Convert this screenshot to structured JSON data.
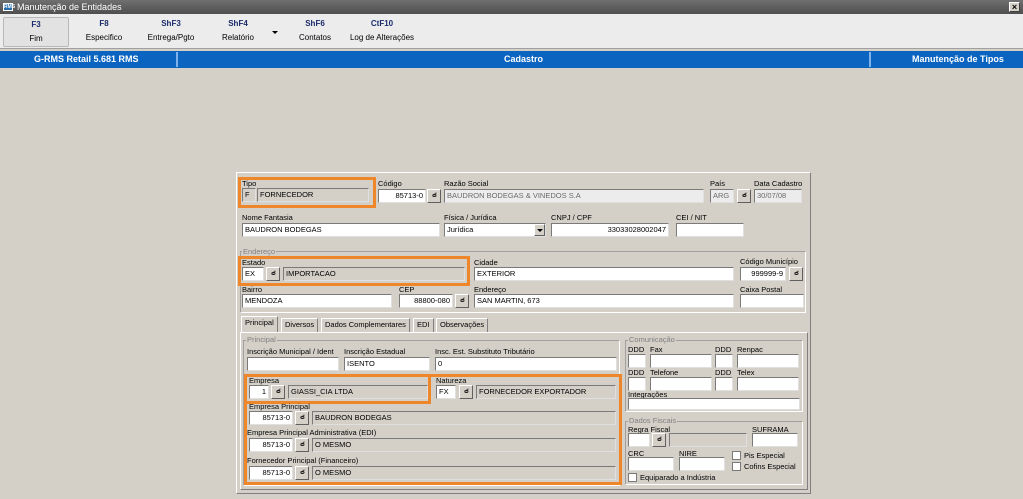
{
  "window": {
    "title": "Manutenção de Entidades",
    "icon": "app-icon"
  },
  "toolbar": {
    "items": [
      {
        "key": "F3",
        "label": "Fim"
      },
      {
        "key": "F8",
        "label": "Especifico"
      },
      {
        "key": "ShF3",
        "label": "Entrega/Pgto"
      },
      {
        "key": "ShF4",
        "label": "Relatório"
      },
      {
        "key": "ShF6",
        "label": "Contatos"
      },
      {
        "key": "CtF10",
        "label": "Log de Alterações"
      }
    ]
  },
  "header": {
    "left": "G-RMS Retail 5.681 RMS",
    "center": "Cadastro",
    "right": "Manutenção de Tipos"
  },
  "form": {
    "tipo": {
      "label": "Tipo",
      "code": "F",
      "desc": "FORNECEDOR"
    },
    "codigo": {
      "label": "Código",
      "value": "85713-0"
    },
    "razao": {
      "label": "Razão Social",
      "value": "BAUDRON BODEGAS & VINEDOS S.A"
    },
    "pais": {
      "label": "País",
      "value": "ARG"
    },
    "data_cadastro": {
      "label": "Data Cadastro",
      "value": "30/07/08"
    },
    "nome_fantasia": {
      "label": "Nome Fantasia",
      "value": "BAUDRON BODEGAS"
    },
    "fisica_juridica": {
      "label": "Física / Jurídica",
      "value": "Jurídica"
    },
    "cnpj": {
      "label": "CNPJ / CPF",
      "value": "33033028002047"
    },
    "cei": {
      "label": "CEI / NIT",
      "value": ""
    },
    "endereco_group": "Endereço",
    "estado": {
      "label": "Estado",
      "code": "EX",
      "desc": "IMPORTACAO"
    },
    "cidade": {
      "label": "Cidade",
      "value": "EXTERIOR"
    },
    "cod_municipio": {
      "label": "Código Município",
      "value": "999999-9"
    },
    "bairro": {
      "label": "Bairro",
      "value": "MENDOZA"
    },
    "cep": {
      "label": "CEP",
      "value": "88800-080"
    },
    "endereco": {
      "label": "Endereço",
      "value": "SAN MARTIN, 673"
    },
    "caixa_postal": {
      "label": "Caixa Postal",
      "value": ""
    }
  },
  "tabs": [
    "Principal",
    "Diversos",
    "Dados Complementares",
    "EDI",
    "Observações"
  ],
  "principal": {
    "group": "Principal",
    "insc_municipal": {
      "label": "Inscrição Municipal / Ident",
      "value": ""
    },
    "insc_estadual": {
      "label": "Inscrição Estadual",
      "value": "ISENTO"
    },
    "insc_st": {
      "label": "Insc. Est. Substituto Tributário",
      "value": "0"
    },
    "empresa": {
      "label": "Empresa",
      "code": "1",
      "desc": "GIASSI_CIA LTDA"
    },
    "natureza": {
      "label": "Natureza",
      "code": "FX",
      "desc": "FORNECEDOR EXPORTADOR"
    },
    "empresa_principal": {
      "label": "Empresa Principal",
      "code": "85713-0",
      "desc": "BAUDRON BODEGAS"
    },
    "empresa_adm": {
      "label": "Empresa Principal Administrativa (EDI)",
      "code": "85713-0",
      "desc": "O MESMO"
    },
    "fornecedor_fin": {
      "label": "Fornecedor Principal (Financeiro)",
      "code": "85713-0",
      "desc": "O MESMO"
    }
  },
  "comunicacao": {
    "group": "Comunicação",
    "ddd1": "DDD",
    "fax": "Fax",
    "ddd2": "DDD",
    "renpac": "Renpac",
    "ddd3": "DDD",
    "telefone": "Telefone",
    "ddd4": "DDD",
    "telex": "Telex",
    "integracoes": "Integrações"
  },
  "fiscais": {
    "group": "Dados Fiscais",
    "regra_fiscal": "Regra Fiscal",
    "suframa": "SUFRAMA",
    "crc": "CRC",
    "nire": "NIRE",
    "pis": "Pis Especial",
    "cofins": "Cofins Especial",
    "equiparado": "Equiparado a Indústria"
  }
}
